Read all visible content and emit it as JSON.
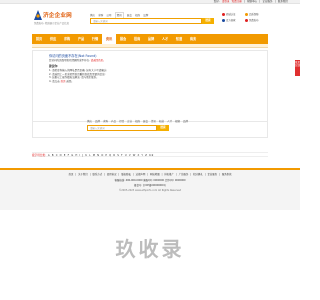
{
  "topbar": {
    "links": [
      "您好,",
      "请登录",
      "免费注册",
      "|",
      "帮助中心",
      "|",
      "企业服务",
      "|",
      "联系我们"
    ]
  },
  "logo": {
    "name": "济企企业网",
    "slogan": "免费发布, 精准展示企业产品信息"
  },
  "search": {
    "tabs": [
      "供应",
      "求购",
      "公司",
      "资讯",
      "展会",
      "招商",
      "品牌"
    ],
    "active_tab": "资讯",
    "placeholder": "请输入关键词",
    "button": "搜索"
  },
  "badges": [
    {
      "label": "商城认证",
      "color": "#e02020"
    },
    {
      "label": "品质保障",
      "color": "#f29a00"
    },
    {
      "label": "百万商家",
      "color": "#1a4aa0"
    },
    {
      "label": "免费发布",
      "color": "#e02020"
    }
  ],
  "nav": {
    "items": [
      "首页",
      "供应",
      "求购",
      "产品",
      "行情",
      "资讯",
      "展会",
      "招商",
      "品牌",
      "人才",
      "知道",
      "商务"
    ],
    "active": "资讯"
  },
  "error": {
    "title": "你访问的页面不存在(Not Found)",
    "line1_prefix": "您访问的页面可能已经删除或不存在,",
    "line1_link": "请返回首页。",
    "head": "建议你:",
    "lines": [
      "1. 请检查你输入的网址是否正确, 如有大小写请确认;",
      "2. 请返回上一页或者到首页重新查找您需要的信息;",
      "3. 如果以上操作都无法解决, 请与我们联系。"
    ],
    "line4_prefix": "4. 请点击",
    "line4_link": "首页",
    "line4_suffix": "返回。"
  },
  "bottom_search": {
    "tabs": [
      "供应",
      "品牌",
      "求购",
      "产品",
      "行情",
      "企业",
      "招商",
      "展会",
      "资讯",
      "知道",
      "人才",
      "视频",
      "品牌"
    ],
    "placeholder": "请输入关键词",
    "button": "搜索"
  },
  "alpha": {
    "label": "按字母分类:",
    "letters": [
      "A",
      "B",
      "C",
      "D",
      "E",
      "F",
      "G",
      "H",
      "I",
      "J",
      "K",
      "L",
      "M",
      "N",
      "O",
      "P",
      "Q",
      "R",
      "S",
      "T",
      "U",
      "V",
      "W",
      "X",
      "Y",
      "Z",
      "0-9"
    ]
  },
  "footer": {
    "links": [
      "首页",
      "关于我们",
      "联系方式",
      "使用协议",
      "版权隐私",
      "法律声明",
      "网站地图",
      "排名推广",
      "广告服务",
      "积分换礼",
      "企业服务",
      "服务条款"
    ],
    "contact": "客服热线: 400-000-0000 客服QQ: 0000000 合作QQ: 0000000",
    "copyright": "©2005-2023 www.ethpinfo.com All Rights Reserved",
    "beian": "备案号: 京ICP备00000000号"
  },
  "watermark": "玖收录",
  "side_tab": "意见反馈"
}
